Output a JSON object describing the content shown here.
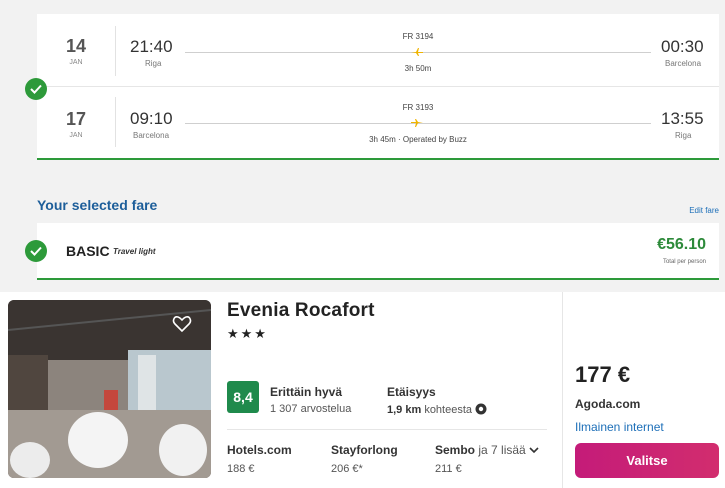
{
  "flights": {
    "outbound": {
      "day": "14",
      "month": "JAN",
      "dep_time": "21:40",
      "dep_city": "Riga",
      "flight_no": "FR 3194",
      "duration": "3h 50m",
      "arr_time": "00:30",
      "arr_city": "Barcelona"
    },
    "inbound": {
      "day": "17",
      "month": "JAN",
      "dep_time": "09:10",
      "dep_city": "Barcelona",
      "flight_no": "FR 3193",
      "duration": "3h 45m · Operated by Buzz",
      "arr_time": "13:55",
      "arr_city": "Riga"
    }
  },
  "fare": {
    "section_title": "Your selected fare",
    "edit_label": "Edit fare",
    "name": "BASIC",
    "subtitle": "Travel light",
    "price": "€56.10",
    "price_note": "Total per person"
  },
  "hotel": {
    "name": "Evenia Rocafort",
    "stars": "★★★",
    "rating": "8,4",
    "rating_label": "Erittäin hyvä",
    "rating_count": "1 307 arvostelua",
    "distance_label": "Etäisyys",
    "distance_value": "1,9 km",
    "distance_suffix": "kohteesta",
    "providers": [
      {
        "name": "Hotels.com",
        "price": "188 €"
      },
      {
        "name": "Stayforlong",
        "price": "206 €*"
      },
      {
        "name": "Sembo",
        "extra": "ja 7 lisää",
        "price": "211 €"
      }
    ],
    "deal": {
      "price": "177 €",
      "site": "Agoda.com",
      "note": "Ilmainen internet",
      "button": "Valitse"
    }
  },
  "colors": {
    "accent_green": "#2d9a3a",
    "rating_green": "#1f8a4c",
    "link_blue": "#1d6fb8",
    "button_pink": "#c41b79"
  }
}
